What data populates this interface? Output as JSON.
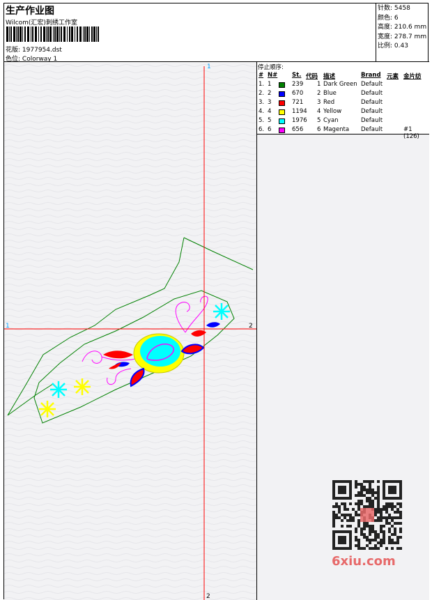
{
  "header": {
    "title": "生产作业图",
    "company": "Wilcom(汇宏)刺绣工作室",
    "design_label": "花版:",
    "design_value": "1977954.dst",
    "colorway_label": "色位:",
    "colorway_value": "Colorway 1"
  },
  "stats": {
    "stitches_label": "针数:",
    "stitches_value": "5458",
    "colors_label": "颜色:",
    "colors_value": "6",
    "height_label": "高度:",
    "height_value": "210.6 mm",
    "width_label": "宽度:",
    "width_value": "278.7 mm",
    "scale_label": "比例:",
    "scale_value": "0.43"
  },
  "stop_sequence": {
    "title": "停止顺序:",
    "headers": {
      "idx": "#",
      "n": "N#",
      "st": "St.",
      "code": "代码",
      "desc": "描述",
      "brand": "Brand",
      "elem": "元素",
      "sequin": "金片纺"
    },
    "rows": [
      {
        "idx": "1.",
        "n": "1",
        "color": "#008000",
        "st": "239",
        "code": "1",
        "desc": "Dark Green",
        "brand": "Default",
        "sequin": ""
      },
      {
        "idx": "2.",
        "n": "2",
        "color": "#0000ff",
        "st": "670",
        "code": "2",
        "desc": "Blue",
        "brand": "Default",
        "sequin": ""
      },
      {
        "idx": "3.",
        "n": "3",
        "color": "#ff0000",
        "st": "721",
        "code": "3",
        "desc": "Red",
        "brand": "Default",
        "sequin": ""
      },
      {
        "idx": "4.",
        "n": "4",
        "color": "#ffff00",
        "st": "1194",
        "code": "4",
        "desc": "Yellow",
        "brand": "Default",
        "sequin": ""
      },
      {
        "idx": "5.",
        "n": "5",
        "color": "#00ffff",
        "st": "1976",
        "code": "5",
        "desc": "Cyan",
        "brand": "Default",
        "sequin": ""
      },
      {
        "idx": "6.",
        "n": "6",
        "color": "#ff00ff",
        "st": "656",
        "code": "6",
        "desc": "Magenta",
        "brand": "Default",
        "sequin": "#1 (126)"
      }
    ]
  },
  "canvas": {
    "mark_top": "1",
    "mark_left": "1",
    "mark_right": "2",
    "mark_bottom": "2",
    "crosshair_color": "#ff0000"
  },
  "watermark": {
    "text": "6xiu.com",
    "color": "#e76a6a"
  }
}
